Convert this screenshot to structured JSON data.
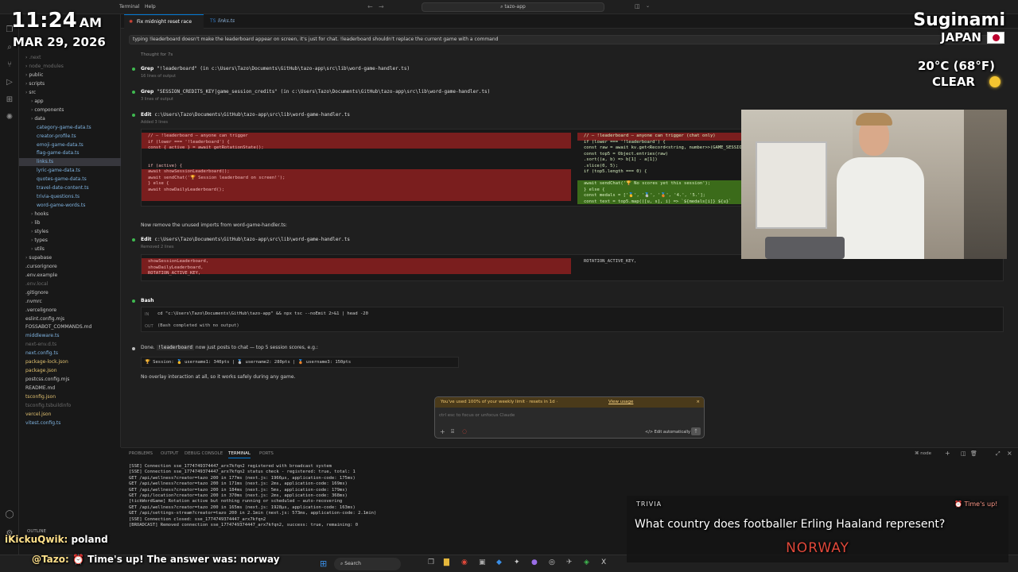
{
  "titlebar": {
    "menus": [
      "Terminal",
      "Help"
    ],
    "search": "tazo-app"
  },
  "tabs": [
    {
      "label": "Fix midnight reset race ..."
    },
    {
      "label": "links.ts"
    }
  ],
  "explorer": {
    "items": [
      ".next",
      "node_modules",
      "public",
      "scripts",
      "src",
      "app",
      "components",
      "data",
      "category-game-data.ts",
      "creator-profile.ts",
      "emoji-game-data.ts",
      "flag-game-data.ts",
      "links.ts",
      "lyric-game-data.ts",
      "quotes-game-data.ts",
      "travel-date-content.ts",
      "trivia-questions.ts",
      "word-game-words.ts",
      "hooks",
      "lib",
      "styles",
      "types",
      "utils",
      "supabase",
      ".cursorignore",
      ".env.example",
      ".env.local",
      ".gitignore",
      ".nvmrc",
      ".vercelignore",
      "eslint.config.mjs",
      "FOSSABOT_COMMANDS.md",
      "middleware.ts",
      "next-env.d.ts",
      "next.config.ts",
      "package-lock.json",
      "package.json",
      "postcss.config.mjs",
      "README.md",
      "tsconfig.json",
      "tsconfig.tsbuildinfo",
      "vercel.json",
      "vitest.config.ts"
    ],
    "outline": "OUTLINE"
  },
  "chat": {
    "user_message": "typing !leaderboard doesn't make the leaderboard appear on screen, it's just for chat. !leaderboard shouldn't replace the current game with a command",
    "thought": "Thought for 7s",
    "steps": [
      {
        "tool": "Grep",
        "detail": "\"!leaderboard\" (in c:\\Users\\Tazo\\Documents\\GitHub\\tazo-app\\src\\lib\\word-game-handler.ts)",
        "sub": "16 lines of output"
      },
      {
        "tool": "Grep",
        "detail": "\"SESSION_CREDITS_KEY|game_session_credits\" (in c:\\Users\\Tazo\\Documents\\GitHub\\tazo-app\\src\\lib\\word-game-handler.ts)",
        "sub": "3 lines of output"
      },
      {
        "tool": "Edit",
        "detail": "c:\\Users\\Tazo\\Documents\\GitHub\\tazo-app\\src\\lib\\word-game-handler.ts",
        "sub": "Added 3 lines"
      }
    ],
    "diff1_left": [
      "// — !leaderboard — anyone can trigger",
      "if (lower === '!leaderboard') {",
      "  const { active } = await getRotationState();",
      "",
      "",
      "  if (active) {",
      "    await showSessionLeaderboard();",
      "    await sendChat('🏆 Session leaderboard on screen!');",
      "  } else {",
      "    await showDailyLeaderboard();"
    ],
    "diff1_right": [
      "// — !leaderboard — anyone can trigger (chat only)",
      "if (lower === '!leaderboard') {",
      "  const raw = await kv.get<Record<string, number>>(GAME_SESSION...",
      "  const top5 = Object.entries(raw)",
      "    .sort((a, b) => b[1] - a[1])",
      "    .slice(0, 5);",
      "  if (top5.length === 0) {",
      "",
      "    await sendChat('🏆 No scores yet this session');",
      "  } else {",
      "    const medals = ['🥇', '🥈', '🥉', '4.', '5.'];",
      "    const text = top5.map(([u, s], i) => `${medals[i]} ${u}`"
    ],
    "note1": "Now remove the unused imports from word-game-handler.ts:",
    "edit2": {
      "tool": "Edit",
      "detail": "c:\\Users\\Tazo\\Documents\\GitHub\\tazo-app\\src\\lib\\word-game-handler.ts",
      "sub": "Removed 2 lines"
    },
    "diff2_left": [
      "showSessionLeaderboard,",
      "showDailyLeaderboard,",
      "ROTATION_ACTIVE_KEY,"
    ],
    "diff2_right": [
      "ROTATION_ACTIVE_KEY,"
    ],
    "bash": {
      "tool": "Bash",
      "in_label": "IN",
      "command": "cd \"c:\\Users\\Tazo\\Documents\\GitHub\\tazo-app\" && npx tsc --noEmit 2>&1 | head -20",
      "out_label": "OUT",
      "output": "(Bash completed with no output)"
    },
    "done_prefix": "Done.",
    "done_code": "!leaderboard",
    "done_text": "now just posts to chat — top 5 session scores, e.g.:",
    "example": "🏆 Session: 🥇 username1: 340pts | 🥈 username2: 280pts | 🥉 username3: 150pts",
    "closing": "No overlay interaction at all, so it works safely during any game."
  },
  "input": {
    "limit_text": "You've used 100% of your weekly limit · resets in 1d ·",
    "view_usage": "View usage",
    "placeholder": "ctrl esc to focus or unfocus Claude",
    "mode": "Edit automatically"
  },
  "panel": {
    "tabs": [
      "PROBLEMS",
      "OUTPUT",
      "DEBUG CONSOLE",
      "TERMINAL",
      "PORTS"
    ],
    "node_label": "node",
    "lines": [
      "[SSE] Connection sse_1774749374447_arx7kfqn2 registered with broadcast system",
      "[SSE] Connection sse_1774749374447_arx7kfqn2 status check - registered: true, total: 1",
      " GET /api/wellness?creator=tazo 200 in 177ms (next.js: 1966µs, application-code: 175ms)",
      " GET /api/wellness?creator=tazo 200 in 171ms (next.js: 2ms, application-code: 169ms)",
      " GET /api/wellness?creator=tazo 200 in 184ms (next.js: 5ms, application-code: 179ms)",
      " GET /api/location?creator=tazo 200 in 370ms (next.js: 2ms, application-code: 368ms)",
      "[tickWordGame] Rotation active but nothing running or scheduled — auto-recovering",
      " GET /api/wellness?creator=tazo 200 in 165ms (next.js: 1928µs, application-code: 163ms)",
      " GET /api/settings-stream?creator=tazo 200 in 2.1min (next.js: 573ms, application-code: 2.1min)",
      "[SSE] Connection closed: sse_1774749374447_arx7kfqn2",
      "[BROADCAST] Removed connection sse_1774749374447_arx7kfqn2, success: true, remaining: 0"
    ]
  },
  "taskbar": {
    "search": "Search"
  },
  "overlay": {
    "time": "11:24",
    "ampm": "AM",
    "date": "MAR 29, 2026",
    "city": "Suginami",
    "country": "JAPAN",
    "weather": "20°C (68°F)",
    "condition": "CLEAR",
    "chat_user1": "iKickuQwik:",
    "chat_msg1": "poland",
    "chat_user2": "@Tazo:",
    "chat_msg2": "Time's up! The answer was: norway",
    "trivia_label": "TRIVIA",
    "trivia_status": "Time's up!",
    "trivia_question": "What country does footballer Erling Haaland represent?",
    "trivia_answer": "NORWAY"
  },
  "colors": {
    "accent": "#0078d4",
    "diff_removed": "#7a1e1e",
    "diff_added": "#3b6b1a",
    "answer": "#e0483a",
    "warning": "#f0c770"
  }
}
